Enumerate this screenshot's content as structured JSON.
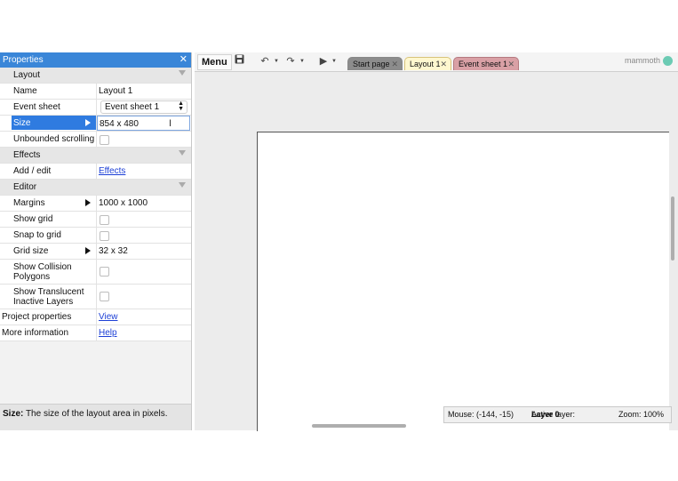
{
  "properties": {
    "title": "Properties",
    "close_glyph": "✕",
    "groups": {
      "layout": "Layout",
      "effects": "Effects",
      "editor": "Editor"
    },
    "rows": {
      "name": {
        "label": "Name",
        "value": "Layout 1"
      },
      "event_sheet": {
        "label": "Event sheet",
        "value": "Event sheet 1"
      },
      "size": {
        "label": "Size",
        "value": "854 x 480"
      },
      "unbounded_scrolling": {
        "label": "Unbounded scrolling"
      },
      "add_edit": {
        "label": "Add / edit",
        "value": "Effects"
      },
      "margins": {
        "label": "Margins",
        "value": "1000 x 1000"
      },
      "show_grid": {
        "label": "Show grid"
      },
      "snap_to_grid": {
        "label": "Snap to grid"
      },
      "grid_size": {
        "label": "Grid size",
        "value": "32 x 32"
      },
      "show_collision_polygons": {
        "label_line1": "Show Collision",
        "label_line2": "Polygons"
      },
      "show_translucent_inactive_layers": {
        "label_line1": "Show Translucent",
        "label_line2": "Inactive Layers"
      },
      "project_properties": {
        "label": "Project properties",
        "value": "View"
      },
      "more_information": {
        "label": "More information",
        "value": "Help"
      }
    },
    "description": {
      "bold": "Size:",
      "text": " The size of the layout area in pixels."
    }
  },
  "toolbar": {
    "menu_label": "Menu",
    "icons": [
      "save-icon",
      "undo-icon",
      "redo-icon",
      "play-icon"
    ],
    "tabs": [
      {
        "label": "Start page",
        "close": "✕"
      },
      {
        "label": "Layout 1",
        "close": "✕"
      },
      {
        "label": "Event sheet 1",
        "close": "✕"
      }
    ],
    "brand": "mammoth"
  },
  "status": {
    "mouse": "Mouse: (-144, -15)",
    "active_layer_label": "Active layer:",
    "active_layer_value": "Layer 0",
    "zoom": "Zoom: 100%"
  },
  "colors": {
    "panel_title_bg": "#3a86d8",
    "selected_row": "#2f7be0",
    "tab_layout": "#fff7cf",
    "tab_event": "#d9a0a5",
    "tab_start": "#8c8c8c"
  }
}
